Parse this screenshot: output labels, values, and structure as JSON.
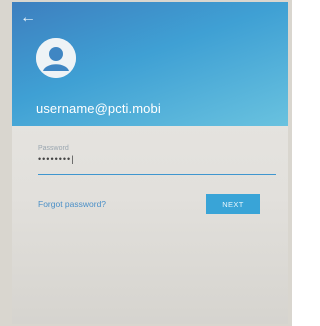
{
  "header": {
    "back_icon": "arrow-left-icon",
    "username": "username@pcti.mobi"
  },
  "password": {
    "label": "Password",
    "value": "••••••••|"
  },
  "actions": {
    "forgot_label": "Forgot password?",
    "next_label": "NEXT"
  },
  "colors": {
    "header_blue": "#3fa0d4",
    "accent": "#39a4d7"
  }
}
